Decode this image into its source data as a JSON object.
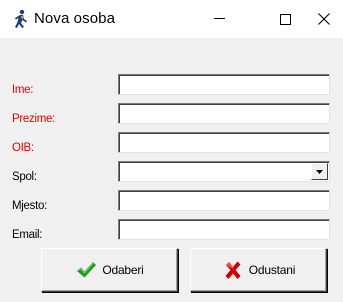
{
  "window": {
    "title": "Nova osoba",
    "icon": "person-run-icon",
    "controls": {
      "minimize": "minimize-icon",
      "maximize": "maximize-icon",
      "close": "close-icon"
    }
  },
  "form": {
    "fields": [
      {
        "key": "ime",
        "label": "Ime:",
        "required": true,
        "value": ""
      },
      {
        "key": "prezime",
        "label": "Prezime:",
        "required": true,
        "value": ""
      },
      {
        "key": "oib",
        "label": "OIB:",
        "required": true,
        "value": ""
      },
      {
        "key": "spol",
        "label": "Spol:",
        "required": false,
        "value": "",
        "type": "select"
      },
      {
        "key": "mjesto",
        "label": "Mjesto:",
        "required": false,
        "value": ""
      },
      {
        "key": "email",
        "label": "Email:",
        "required": false,
        "value": ""
      }
    ]
  },
  "buttons": {
    "ok_label": "Odaberi",
    "ok_icon": "checkmark-icon",
    "cancel_label": "Odustani",
    "cancel_icon": "x-icon"
  },
  "colors": {
    "required_label": "#e60000",
    "check_green": "#1e9a1e",
    "cancel_red": "#cc0000",
    "client_bg": "#f0f0f0"
  }
}
